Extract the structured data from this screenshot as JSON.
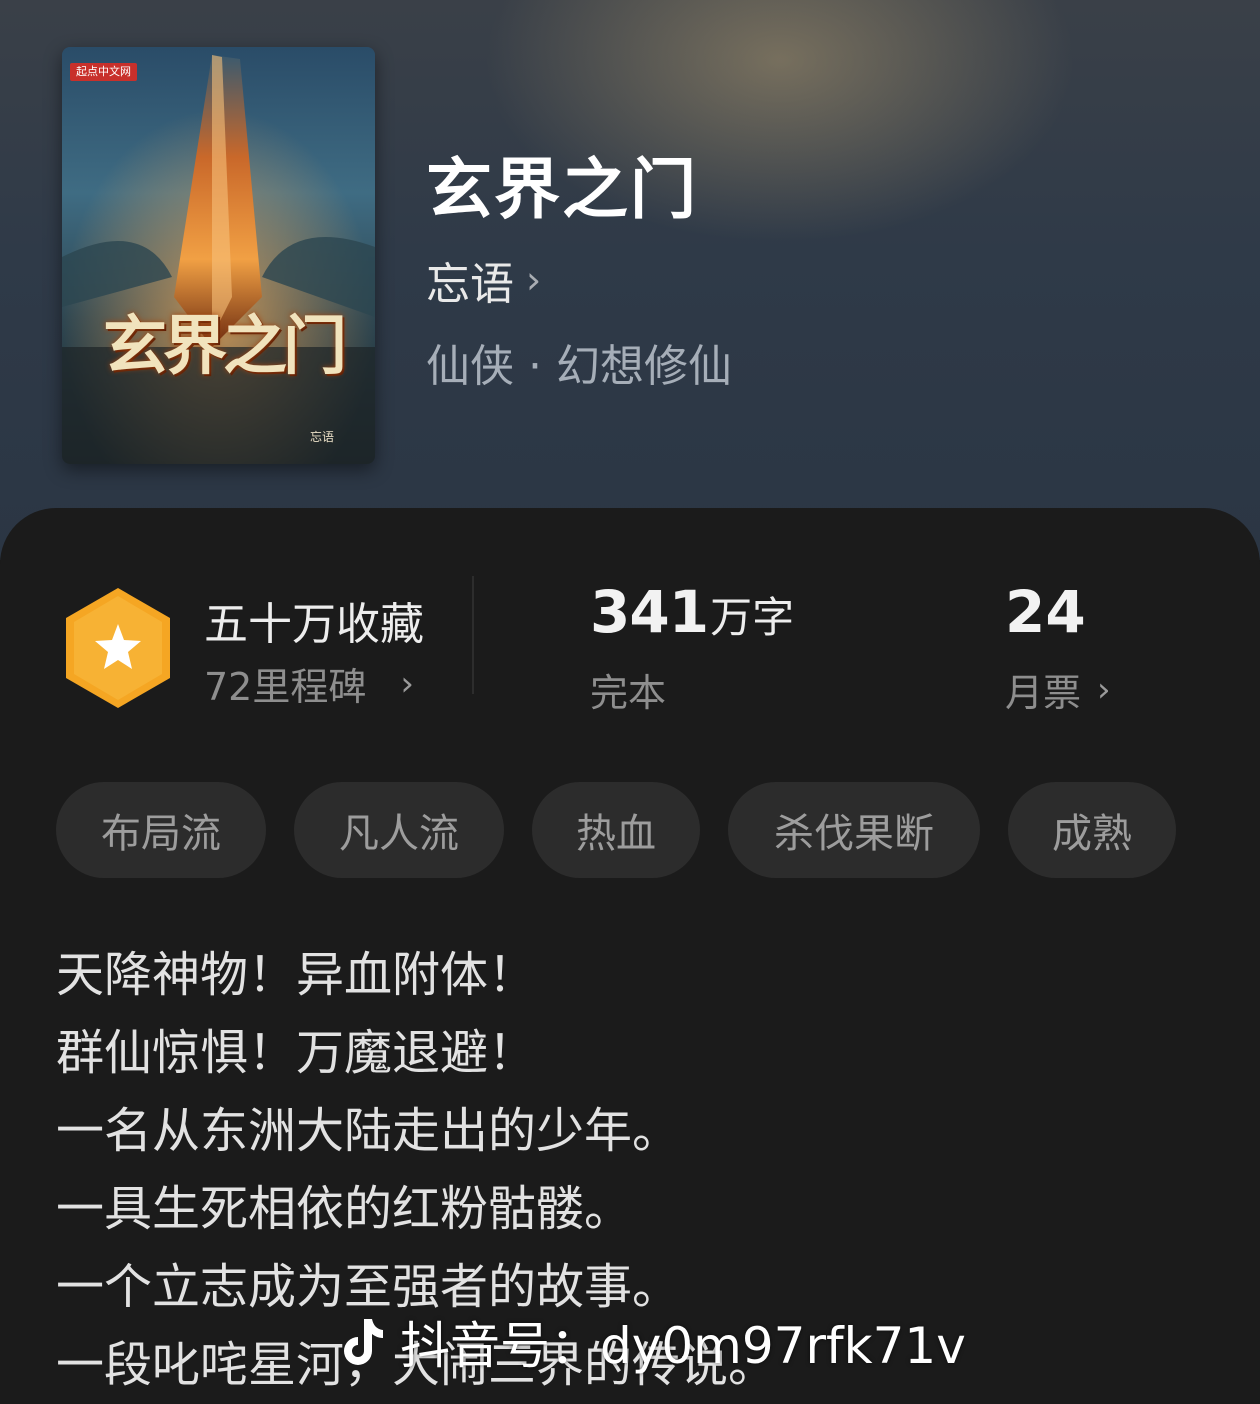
{
  "book": {
    "cover_publisher": "起点中文网",
    "cover_title": "玄界之门",
    "cover_author": "忘语",
    "title": "玄界之门",
    "author": "忘语",
    "genre": "仙侠 · 幻想修仙"
  },
  "stats": {
    "collect_title": "五十万收藏",
    "milestone": "72里程碑",
    "word_count": "341",
    "word_unit": "万字",
    "status": "完本",
    "monthly_votes": "24",
    "votes_label": "月票"
  },
  "tags": [
    "布局流",
    "凡人流",
    "热血",
    "杀伐果断",
    "成熟"
  ],
  "description": [
    "天降神物！异血附体！",
    "群仙惊惧！万魔退避！",
    "一名从东洲大陆走出的少年。",
    "一具生死相依的红粉骷髅。",
    "一个立志成为至强者的故事。",
    "一段叱咤星河，大闹三界的传说。"
  ],
  "watermark": "抖音号：dy0m97rfk71v",
  "colors": {
    "panel_bg": "#1b1b1b",
    "hero_bg": "#2f3a48",
    "badge_orange": "#f5a623",
    "tag_bg": "#2c2c2c"
  }
}
